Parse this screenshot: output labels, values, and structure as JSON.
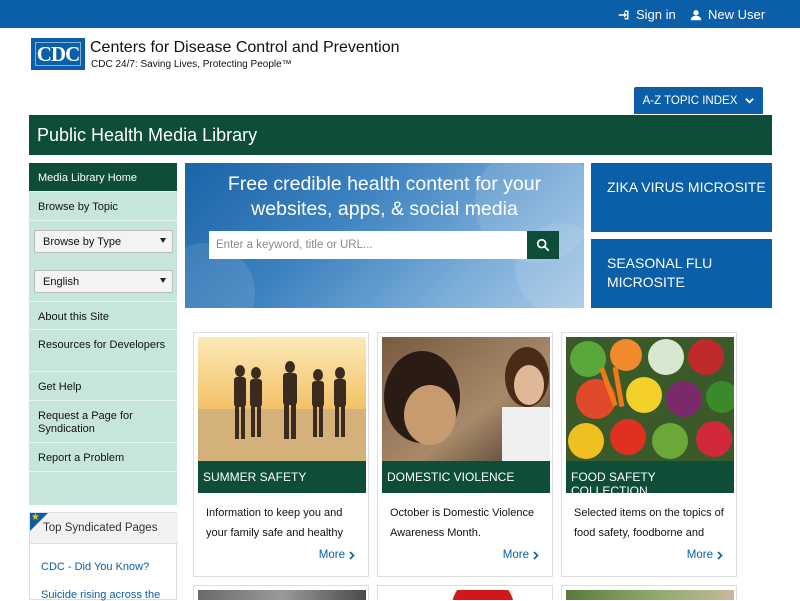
{
  "topbar": {
    "signin": "Sign in",
    "newuser": "New User",
    "bg": "#0b5ea8"
  },
  "header": {
    "logo_text": "CDC",
    "org_name": "Centers for Disease Control and Prevention",
    "tagline": "CDC 24/7: Saving Lives, Protecting People™",
    "az_index": "A-Z TOPIC INDEX"
  },
  "title_bar": {
    "title": "Public Health Media Library"
  },
  "sidebar": {
    "items": [
      {
        "label": "Media Library Home"
      },
      {
        "label": "Browse by Topic"
      },
      {
        "label": "About this Site"
      },
      {
        "label": "Resources for Developers"
      },
      {
        "label": "Get Help"
      },
      {
        "label": "Request a Page for Syndication"
      },
      {
        "label": "Report a Problem"
      }
    ],
    "type_select": "Browse by Type",
    "lang_select": "English"
  },
  "hero": {
    "headline": "Free credible health content for your websites, apps, & social media",
    "search_placeholder": "Enter a keyword, title or URL..."
  },
  "promos": [
    {
      "label": "ZIKA VIRUS MICROSITE"
    },
    {
      "label": "SEASONAL FLU MICROSITE"
    }
  ],
  "cards": [
    {
      "label": "SUMMER SAFETY",
      "desc": "Information to keep you and your family safe and healthy",
      "more": "More"
    },
    {
      "label": "DOMESTIC VIOLENCE",
      "desc": "October is Domestic Violence Awareness Month.",
      "more": "More"
    },
    {
      "label": "FOOD SAFETY COLLECTION",
      "desc": "Selected items on the topics of food safety, foodborne and",
      "more": "More"
    }
  ],
  "top_syndicated": {
    "title": "Top Syndicated Pages",
    "links": [
      "CDC - Did You Know?",
      "Suicide rising across the"
    ]
  },
  "colors": {
    "primary_blue": "#0b5ea8",
    "dark_green": "#0d4d3a",
    "sidebar_green": "#c7e6db"
  }
}
